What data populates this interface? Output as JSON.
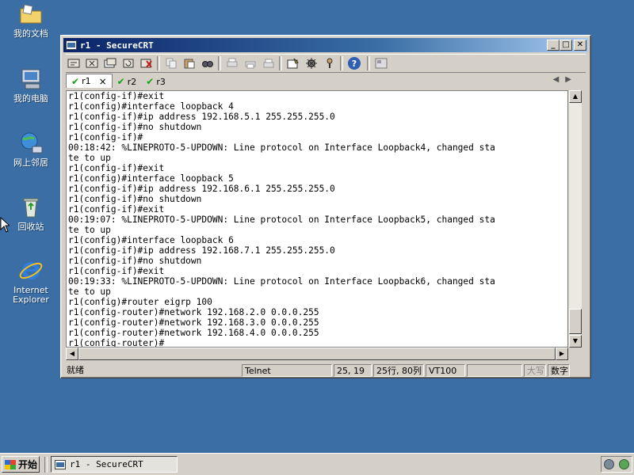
{
  "desktop": {
    "icons": [
      {
        "label": "我的文档"
      },
      {
        "label": "我的电脑"
      },
      {
        "label": "网上邻居"
      },
      {
        "label": "回收站"
      },
      {
        "label": "Internet Explorer"
      }
    ]
  },
  "window": {
    "title": "r1 - SecureCRT",
    "buttons": {
      "minimize": "_",
      "maximize": "□",
      "close": "✕"
    },
    "tabs": [
      {
        "label": "r1",
        "close": "×"
      },
      {
        "label": "r2"
      },
      {
        "label": "r3"
      }
    ],
    "tab_nav": {
      "prev": "◀",
      "next": "▶"
    },
    "terminal_lines": [
      "r1(config-if)#exit",
      "r1(config)#interface loopback 4",
      "r1(config-if)#ip address 192.168.5.1 255.255.255.0",
      "r1(config-if)#no shutdown",
      "r1(config-if)#",
      "00:18:42: %LINEPROTO-5-UPDOWN: Line protocol on Interface Loopback4, changed sta",
      "te to up",
      "r1(config-if)#exit",
      "r1(config)#interface loopback 5",
      "r1(config-if)#ip address 192.168.6.1 255.255.255.0",
      "r1(config-if)#no shutdown",
      "r1(config-if)#exit",
      "00:19:07: %LINEPROTO-5-UPDOWN: Line protocol on Interface Loopback5, changed sta",
      "te to up",
      "r1(config)#interface loopback 6",
      "r1(config-if)#ip address 192.168.7.1 255.255.255.0",
      "r1(config-if)#no shutdown",
      "r1(config-if)#exit",
      "00:19:33: %LINEPROTO-5-UPDOWN: Line protocol on Interface Loopback6, changed sta",
      "te to up",
      "r1(config)#router eigrp 100",
      "r1(config-router)#network 192.168.2.0 0.0.0.255",
      "r1(config-router)#network 192.168.3.0 0.0.0.255",
      "r1(config-router)#network 192.168.4.0 0.0.0.255",
      "r1(config-router)#"
    ],
    "status": {
      "ready": "就绪",
      "protocol": "Telnet",
      "cursor": "25, 19",
      "size": "25行, 80列",
      "emulation": "VT100",
      "caps": "大写",
      "num": "数字"
    },
    "scroll_arrows": {
      "up": "▲",
      "down": "▼",
      "left": "◀",
      "right": "▶"
    }
  },
  "taskbar": {
    "start_label": "开始",
    "task_label": "r1 - SecureCRT"
  }
}
